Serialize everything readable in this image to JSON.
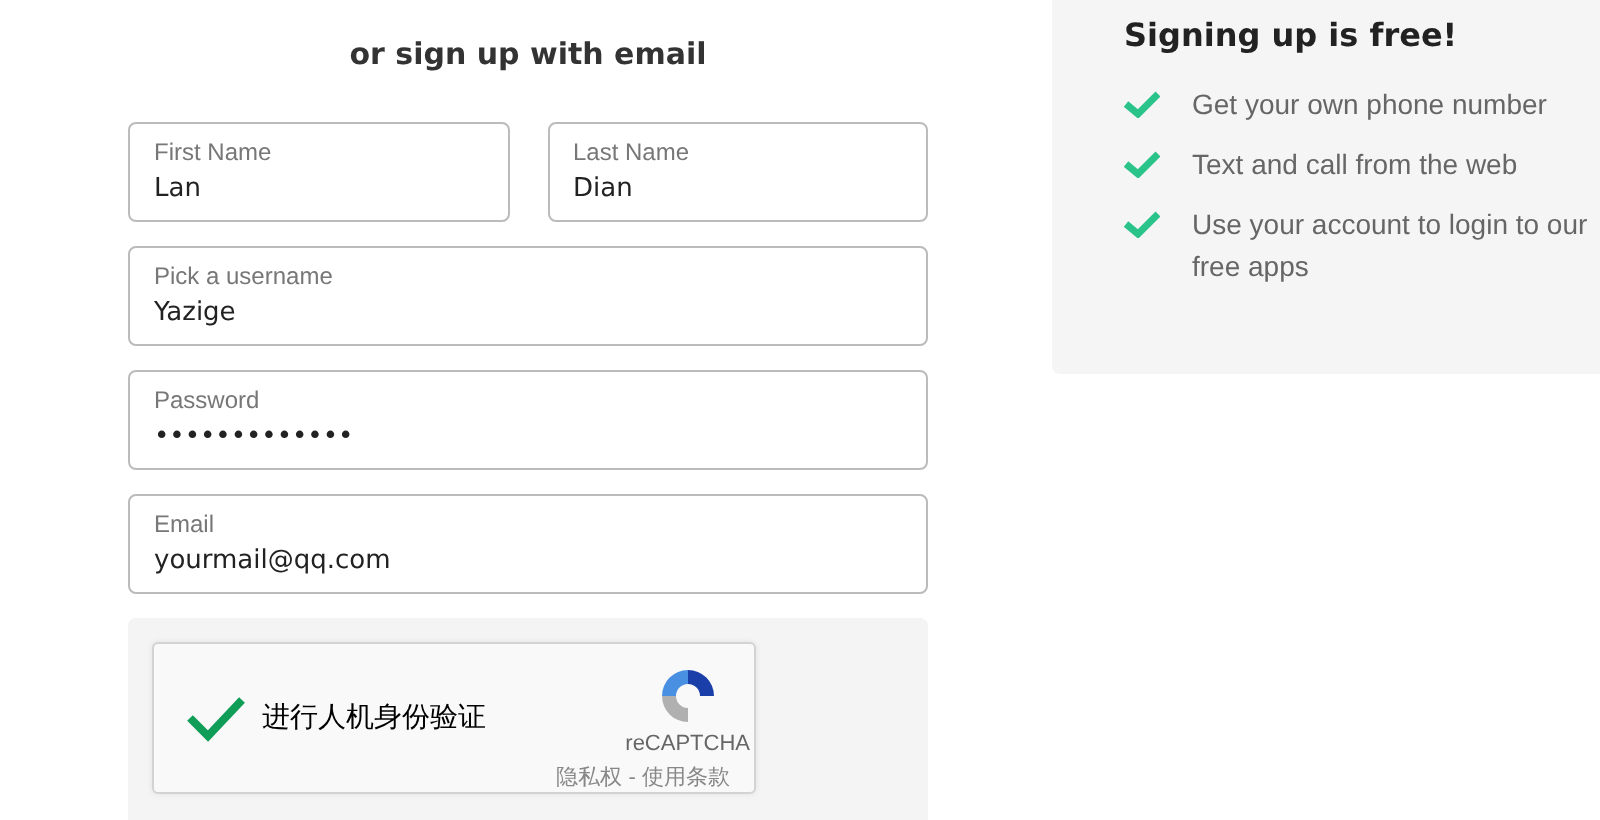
{
  "form": {
    "heading": "or sign up with email",
    "name_fields": [
      {
        "label": "First Name",
        "value": "Lan"
      },
      {
        "label": "Last Name",
        "value": "Dian"
      }
    ],
    "fields": [
      {
        "label": "Pick a username",
        "value": "Yazige"
      },
      {
        "label": "Password",
        "value": "•••••••••••••"
      },
      {
        "label": "Email",
        "value": "yourmail@qq.com"
      }
    ],
    "captcha": {
      "checked": true,
      "label": "进行人机身份验证",
      "brand": "reCAPTCHA",
      "links": "隐私权 - 使用条款"
    }
  },
  "benefits": {
    "title": "Signing up is free!",
    "items": [
      "Get your own phone number",
      "Text and call from the web",
      "Use your account to login to our free apps"
    ]
  }
}
